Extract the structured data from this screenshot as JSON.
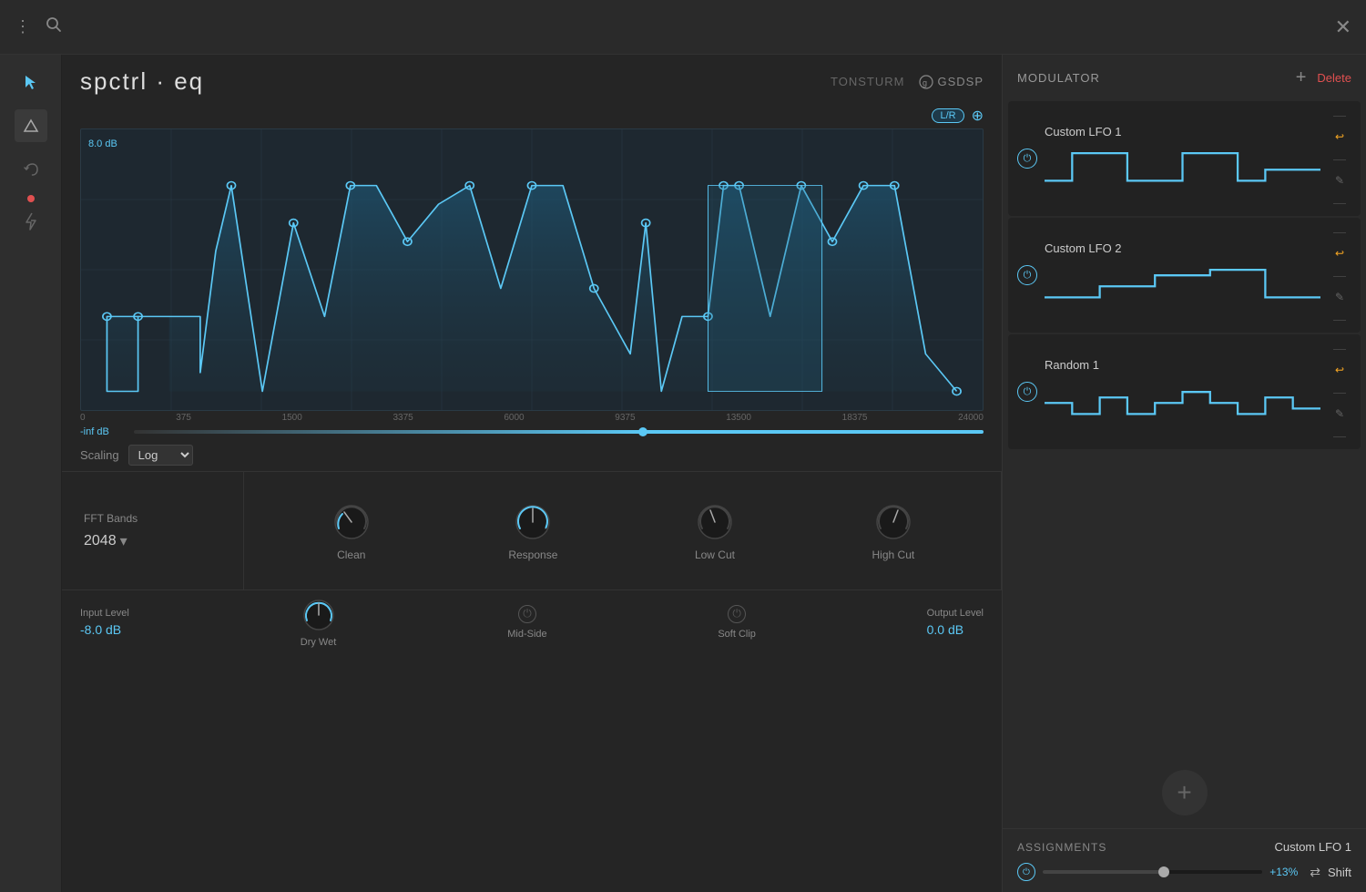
{
  "topbar": {
    "close_label": "✕"
  },
  "app": {
    "title": "spctrl · eq",
    "brand_tonsturm": "TONSTURM",
    "brand_gs": "GSDSP"
  },
  "eq": {
    "db_top": "8.0 dB",
    "db_bottom": "-inf dB",
    "lr_label": "L/R",
    "freq_labels": [
      "0",
      "375",
      "1500",
      "3375",
      "6000",
      "9375",
      "13500",
      "18375",
      "24000"
    ],
    "scaling_label": "Scaling",
    "scaling_value": "Log"
  },
  "fft": {
    "label": "FFT Bands",
    "value": "2048"
  },
  "knobs": {
    "clean_label": "Clean",
    "response_label": "Response",
    "lowcut_label": "Low Cut",
    "highcut_label": "High Cut"
  },
  "footer": {
    "input_level_label": "Input Level",
    "input_level_value": "-8.0 dB",
    "drywet_label": "Dry Wet",
    "midside_label": "Mid-Side",
    "softclip_label": "Soft Clip",
    "output_level_label": "Output Level",
    "output_level_value": "0.0 dB"
  },
  "modulator": {
    "title": "MODULATOR",
    "add_label": "+",
    "delete_label": "Delete",
    "items": [
      {
        "name": "Custom LFO 1",
        "active": true
      },
      {
        "name": "Custom LFO 2",
        "active": true
      },
      {
        "name": "Random 1",
        "active": true
      }
    ]
  },
  "assignments": {
    "title": "ASSIGNMENTS",
    "lfo_label": "Custom LFO 1",
    "percent": "+13%",
    "target": "Shift"
  },
  "lefticons": {
    "cursor_label": "▶",
    "undo_label": "↩",
    "bolt_label": "⚡"
  }
}
